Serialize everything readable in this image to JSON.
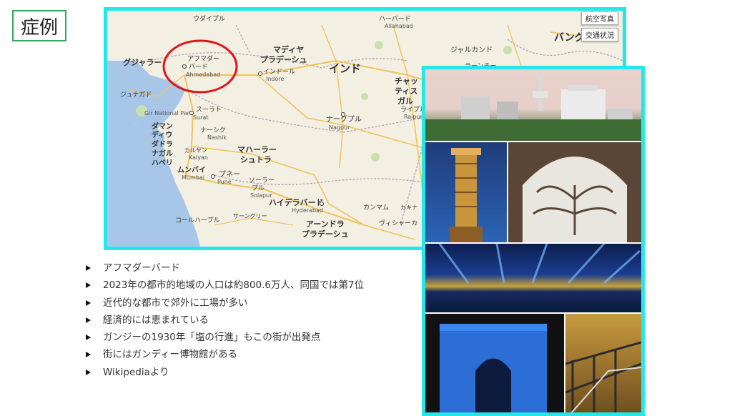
{
  "slide": {
    "title": "症例",
    "bullets": [
      "アフマダーバード",
      "2023年の都市的地域の人口は約800.6万人、同国では第7位",
      "近代的な都市で郊外に工場が多い",
      "経済的には恵まれている",
      "ガンジーの1930年「塩の行進」もこの街が出発点",
      "街にはガンディー博物館がある",
      "Wikipediaより"
    ]
  },
  "map": {
    "buttons": {
      "satellite": "航空写真",
      "traffic": "交通状況"
    },
    "labels": {
      "udaipur": "ウダイプル",
      "harbard": "ハーバード",
      "allahabad": "Allahabad",
      "bangla": "バング",
      "gujarat": "グジャラー",
      "ahmedabad_jp": "アフマダー",
      "ahmedabad_jp2": "バード",
      "ahmedabad_en": "Ahmedabad",
      "madhya1": "マディヤ",
      "madhya2": "プラデーシュ",
      "indore_jp": "インドール",
      "indore_en": "Indore",
      "india": "インド",
      "jharkhand": "ジャルカンド",
      "ranchi": "ラーンチー",
      "chhattisgarh1": "チャッ",
      "chhattisgarh2": "ティス",
      "chhattisgarh3": "ガル",
      "junagadh": "ジュナガド",
      "surat_jp": "スーラト",
      "surat_en": "Surat",
      "daman1": "ダマン",
      "daman2": "ディウ",
      "dadra1": "ダドラ",
      "dadra2": "ナガル",
      "dadra3": "ハベリ",
      "nashik_jp": "ナーシク",
      "nashik_en": "Nashik",
      "nagpur_jp": "ナーグプル",
      "nagpur_en": "Nagpur",
      "kalyan_jp": "カルヤン",
      "kalyan_en": "Kalyan",
      "mumbai_jp": "ムンバイ",
      "mumbai_en": "Mumbai",
      "pune_jp": "プネー",
      "pune_en": "Pune",
      "maharashtra1": "マハーラー",
      "maharashtra2": "シュトラ",
      "solapur_jp": "ソーラー",
      "solapur_jp2": "プル",
      "solapur_en": "Solapur",
      "raipur": "ライプル",
      "raipur_en": "Raipur",
      "hyderabad_jp": "ハイデラバード",
      "hyderabad_en": "Hyderabad",
      "kolhapur_jp": "コールハープル",
      "sangli": "サーングリー",
      "andhra1": "アーンドラ",
      "andhra2": "プラデーシュ",
      "visakha": "ヴィシャーカ",
      "kammam": "カンマム",
      "kakinada": "カキナ",
      "gir": "Gir National Park"
    }
  },
  "colors": {
    "frame": "#22e8ea",
    "title_border": "#2eaa5a",
    "circle": "#e0141b"
  }
}
